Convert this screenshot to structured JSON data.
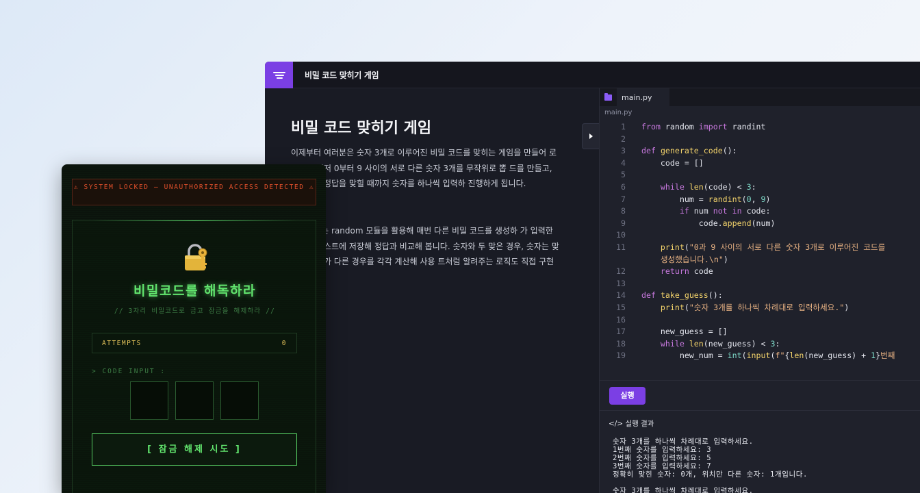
{
  "ide": {
    "title": "비밀 코드 맞히기 게임",
    "lesson_heading": "비밀 코드 맞히기 게임",
    "paragraph1": "이제부터 여러분은 숫자 3개로 이루어진 비밀 코드를 맞히는 게임을 만들어 로그램은 먼저 0부터 9 사이의 서로 다른 숫자 3개를 무작위로 뽑 드를 만들고, 사용자는 정답을 맞힐 때까지 숫자를 하나씩 입력하 진행하게 됩니다.",
    "paragraph2": "젝트에서는 random 모듈을 활용해 매번 다른 비밀 코드를 생성하 가 입력한 숫자를 리스트에 저장해 정답과 비교해 봅니다. 숫자와 두 맞은 경우, 숫자는 맞지만 위치가 다른 경우를 각각 계산해 사용 트처럼 알려주는 로직도 직접 구현합니다.",
    "tab_name": "main.py",
    "breadcrumb": "main.py",
    "run_label": "실행",
    "result_title": "</> 실행 결과",
    "result_output": "숫자 3개를 하나씩 차례대로 입력하세요.\n1번째 숫자를 입력하세요: 3\n2번째 숫자를 입력하세요: 5\n3번째 숫자를 입력하세요: 7\n정확히 맞힌 숫자: 0개, 위치만 다른 숫자: 1개입니다.\n\n숫자 3개를 하나씩 차례대로 입력하세요."
  },
  "code_lines": [
    {
      "n": "1",
      "html": "<span class=\"kw\">from</span> random <span class=\"kw\">import</span> randint"
    },
    {
      "n": "2",
      "html": ""
    },
    {
      "n": "3",
      "html": "<span class=\"kw\">def</span> <span class=\"fn\">generate_code</span>():"
    },
    {
      "n": "4",
      "html": "    code = []"
    },
    {
      "n": "5",
      "html": ""
    },
    {
      "n": "6",
      "html": "    <span class=\"kw\">while</span> <span class=\"fn\">len</span>(code) &lt; <span class=\"nm\">3</span>:"
    },
    {
      "n": "7",
      "html": "        num = <span class=\"fn\">randint</span>(<span class=\"nm\">0</span>, <span class=\"nm\">9</span>)"
    },
    {
      "n": "8",
      "html": "        <span class=\"kw\">if</span> num <span class=\"kw\">not in</span> code:"
    },
    {
      "n": "9",
      "html": "            code.<span class=\"fn\">append</span>(num)"
    },
    {
      "n": "10",
      "html": ""
    },
    {
      "n": "11",
      "html": "    <span class=\"fn\">print</span>(<span class=\"st\">\"0과 9 사이의 서로 다른 숫자 3개로 이루어진 코드를\n    생성했습니다.\\n\"</span>)",
      "wrap": true
    },
    {
      "n": "12",
      "html": "    <span class=\"kw\">return</span> code"
    },
    {
      "n": "13",
      "html": ""
    },
    {
      "n": "14",
      "html": "<span class=\"kw\">def</span> <span class=\"fn\">take_guess</span>():"
    },
    {
      "n": "15",
      "html": "    <span class=\"fn\">print</span>(<span class=\"st\">\"숫자 3개를 하나씩 차례대로 입력하세요.\"</span>)"
    },
    {
      "n": "16",
      "html": ""
    },
    {
      "n": "17",
      "html": "    new_guess = []"
    },
    {
      "n": "18",
      "html": "    <span class=\"kw\">while</span> <span class=\"fn\">len</span>(new_guess) &lt; <span class=\"nm\">3</span>:"
    },
    {
      "n": "19",
      "html": "        new_num = <span class=\"bi\">int</span>(<span class=\"fn\">input</span>(<span class=\"st\">f\"</span>{<span class=\"fn\">len</span>(new_guess) + <span class=\"nm\">1</span>}<span class=\"st\">번째</span>"
    }
  ],
  "game": {
    "alert": "⚠ SYSTEM LOCKED — UNAUTHORIZED ACCESS DETECTED ⚠",
    "title": "비밀코드를 해독하라",
    "subtitle": "// 3자리 비밀코드로 금고 잠금을 해제하라 //",
    "attempts_label": "ATTEMPTS",
    "attempts_value": "0",
    "code_input_label": "> CODE INPUT :",
    "digits": [
      "",
      "",
      ""
    ],
    "unlock_label": "[ 잠금 해제 시도 ]"
  },
  "colors": {
    "accent": "#7b3fe4",
    "terminal_green": "#62e56e",
    "alert_red": "#e0502b",
    "attempts_gold": "#e3c35a"
  },
  "icons": [
    "menu-icon",
    "chevron-right-icon",
    "folder-icon",
    "lock-key-icon"
  ]
}
